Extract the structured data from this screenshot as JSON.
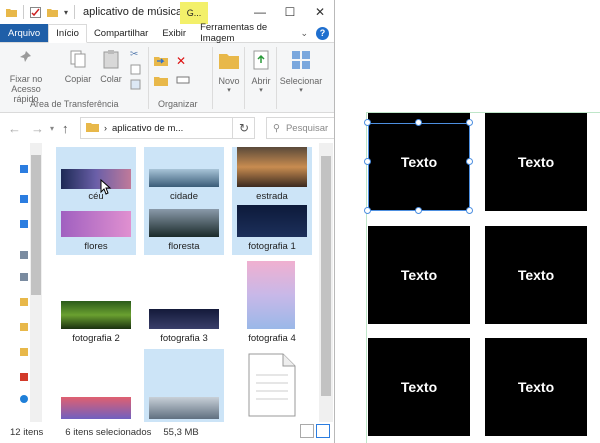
{
  "window": {
    "title": "aplicativo de música",
    "context_tab": "G...",
    "controls": {
      "minimize": "—",
      "maximize": "☐",
      "close": "✕"
    }
  },
  "ribbon_tabs": [
    "Arquivo",
    "Início",
    "Compartilhar",
    "Exibir",
    "Ferramentas de Imagem"
  ],
  "ribbon": {
    "pin_label_1": "Fixar no",
    "pin_label_2": "Acesso rápido",
    "copy": "Copiar",
    "paste": "Colar",
    "group_clipboard": "Área de Transferência",
    "group_organize": "Organizar",
    "new": "Novo",
    "open": "Abrir",
    "select": "Selecionar"
  },
  "address": {
    "path": "aplicativo de m...",
    "search_placeholder": "Pesquisar"
  },
  "files": [
    {
      "name": "céu",
      "selected": true
    },
    {
      "name": "cidade",
      "selected": true
    },
    {
      "name": "estrada",
      "selected": true
    },
    {
      "name": "flores",
      "selected": true
    },
    {
      "name": "floresta",
      "selected": true
    },
    {
      "name": "fotografia 1",
      "selected": false
    },
    {
      "name": "fotografia 2",
      "selected": false
    },
    {
      "name": "fotografia 3",
      "selected": false
    },
    {
      "name": "fotografia 4",
      "selected": false
    },
    {
      "name": "",
      "selected": false
    },
    {
      "name": "",
      "selected": true
    },
    {
      "name": "",
      "selected": false
    }
  ],
  "status": {
    "count": "12 itens",
    "selected": "6 itens selecionados",
    "size": "55,3 MB"
  },
  "canvas": {
    "tiles": [
      "Texto",
      "Texto",
      "Texto",
      "Texto",
      "Texto",
      "Texto"
    ]
  },
  "colors": {
    "selection": "#cce4f7",
    "accent": "#1f5fa8",
    "context_tab": "#f3f06a",
    "handle": "#4d8fe0"
  }
}
